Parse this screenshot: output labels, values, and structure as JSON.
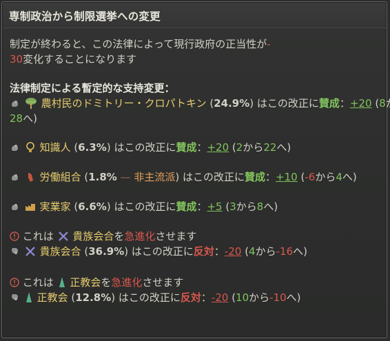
{
  "title": "専制政治から制限選挙への変更",
  "desc": {
    "line1": "制定が終わると、この法律によって現行政府の正当性が",
    "line1_dash": "-",
    "line2_value": "30",
    "line2_rest": "変化することになります"
  },
  "section_heading": "法律制定による暫定的な支持変更：",
  "groups": [
    {
      "name": "農村民のドミトリー・クロパトキン",
      "name_prefix": "農村民の",
      "name_leader": "ドミトリー・クロパトキン",
      "pct": "24.9%",
      "mid": "はこの改正に",
      "stance": "賛成",
      "colon": "：",
      "change": "+20",
      "from": "8",
      "kara": "から",
      "to": "28",
      "he": "へ",
      "icon": "wheat-tree-icon"
    },
    {
      "name": "知識人",
      "pct": "6.3%",
      "mid": "はこの改正に",
      "stance": "賛成",
      "change": "+20",
      "from": "2",
      "to": "22",
      "icon": "lightbulb-icon"
    },
    {
      "name": "労働組合",
      "pct": "1.8%",
      "dash": "—",
      "tag": "非主流派",
      "mid": "はこの改正に",
      "stance": "賛成",
      "change": "+10",
      "from": "-6",
      "to": "4",
      "icon": "fist-icon"
    },
    {
      "name": "実業家",
      "pct": "6.6%",
      "mid": "はこの改正に",
      "stance": "賛成",
      "change": "+5",
      "from": "3",
      "to": "8",
      "icon": "factory-icon"
    },
    {
      "radical_prefix": "これは",
      "radical_group": "貴族会合",
      "radical_wo": "を",
      "radical_word": "急進化",
      "radical_suffix": "させます",
      "name": "貴族会合",
      "pct": "36.9%",
      "mid": "はこの改正に",
      "stance": "反対",
      "change": "-20",
      "from": "4",
      "to": "-16",
      "icon": "crossed-swords-icon"
    },
    {
      "radical_prefix": "これは",
      "radical_group": "正教会",
      "radical_wo": "を",
      "radical_word": "急進化",
      "radical_suffix": "させます",
      "name": "正教会",
      "pct": "12.8%",
      "mid": "はこの改正に",
      "stance": "反対",
      "change": "-20",
      "from": "10",
      "to": "-10",
      "icon": "church-spire-icon"
    }
  ],
  "colors": {
    "positive": "#82c35c",
    "negative": "#d9574e",
    "highlight": "#e6cb6e",
    "text": "#d2d0c6",
    "background": "#2b2c2b"
  }
}
